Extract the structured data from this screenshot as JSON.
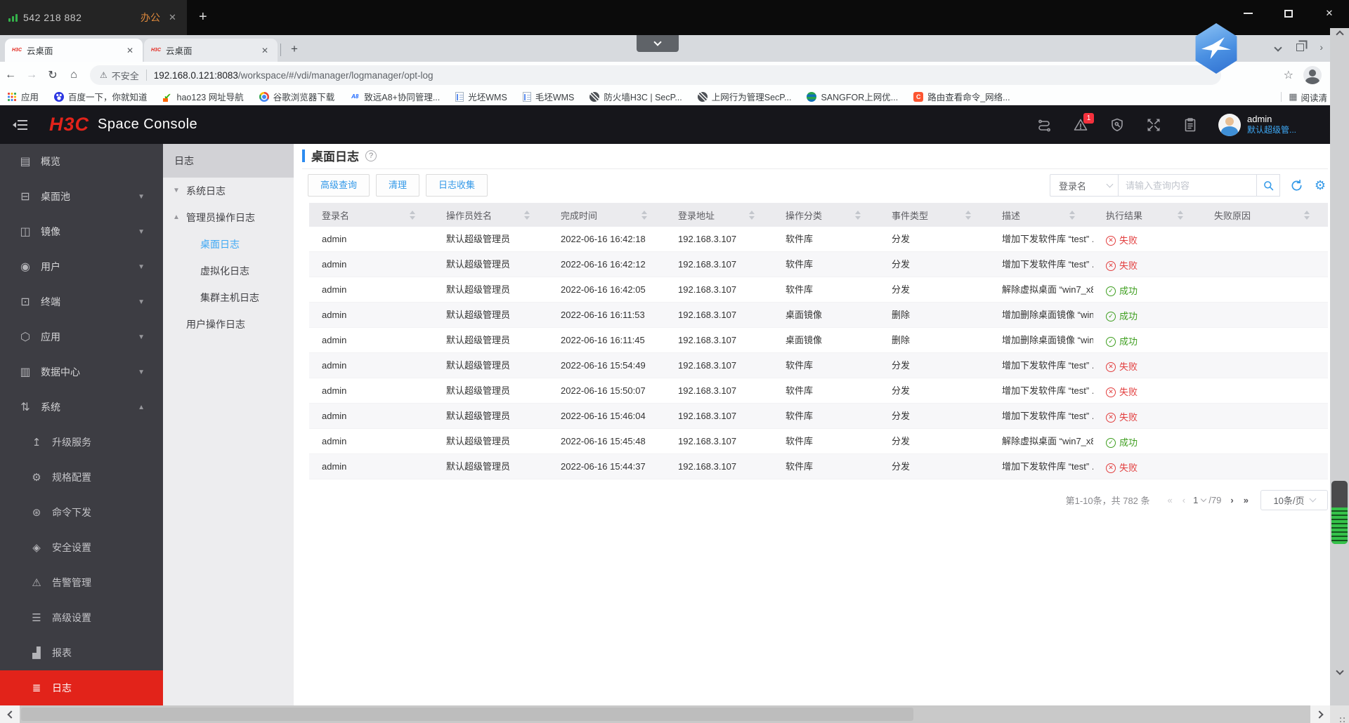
{
  "remote_bar": {
    "session_id": "542 218 882",
    "tab_label": "办公"
  },
  "browser": {
    "tab_favicon_text": "H3C",
    "tabs": [
      {
        "title": "云桌面"
      },
      {
        "title": "云桌面"
      }
    ],
    "address": {
      "security_label": "不安全",
      "host": "192.168.0.121:8083",
      "path": "/workspace/#/vdi/manager/logmanager/opt-log"
    },
    "bookmarks": [
      {
        "icon": "apps-grid-icon",
        "label": "应用"
      },
      {
        "icon": "baidu-icon",
        "label": "百度一下，你就知道"
      },
      {
        "icon": "hao123-icon",
        "label": "hao123 网址导航",
        "glyph": "✔"
      },
      {
        "icon": "chrome-icon",
        "label": "谷歌浏览器下载"
      },
      {
        "icon": "a8-icon",
        "label": "致远A8+协同管理...",
        "glyph": "A8"
      },
      {
        "icon": "doc-icon",
        "label": "光坯WMS"
      },
      {
        "icon": "doc-icon",
        "label": "毛坯WMS"
      },
      {
        "icon": "globe-icon",
        "label": "防火墙H3C | SecP..."
      },
      {
        "icon": "globe-icon",
        "label": "上网行为管理SecP..."
      },
      {
        "icon": "sangfor-icon",
        "label": "SANGFOR上网优..."
      },
      {
        "icon": "csdn-icon",
        "label": "路由查看命令_网络...",
        "glyph": "C"
      }
    ],
    "reading_list_label": "阅读清"
  },
  "app_header": {
    "logo_text": "H3C",
    "product_name": "Space Console",
    "alert_badge": "1",
    "user_name": "admin",
    "user_role": "默认超级管..."
  },
  "sidebar": {
    "items": [
      {
        "label": "概览",
        "icon": "overview-icon",
        "expandable": false
      },
      {
        "label": "桌面池",
        "icon": "desktop-pool-icon",
        "expandable": true
      },
      {
        "label": "镜像",
        "icon": "image-icon",
        "expandable": true
      },
      {
        "label": "用户",
        "icon": "user-icon",
        "expandable": true
      },
      {
        "label": "终端",
        "icon": "terminal-icon",
        "expandable": true
      },
      {
        "label": "应用",
        "icon": "app-icon",
        "expandable": true
      },
      {
        "label": "数据中心",
        "icon": "datacenter-icon",
        "expandable": true
      },
      {
        "label": "系统",
        "icon": "system-icon",
        "expandable": true,
        "expanded": true
      }
    ],
    "system_children": [
      {
        "label": "升级服务",
        "icon": "upgrade-icon"
      },
      {
        "label": "规格配置",
        "icon": "spec-icon"
      },
      {
        "label": "命令下发",
        "icon": "command-icon"
      },
      {
        "label": "安全设置",
        "icon": "security-icon"
      },
      {
        "label": "告警管理",
        "icon": "alarm-icon"
      },
      {
        "label": "高级设置",
        "icon": "advanced-icon"
      },
      {
        "label": "报表",
        "icon": "report-icon"
      },
      {
        "label": "日志",
        "icon": "log-icon",
        "active": true
      }
    ]
  },
  "log_panel": {
    "title": "日志",
    "tree": [
      {
        "label": "系统日志",
        "level": 0,
        "arrow": "collapsed"
      },
      {
        "label": "管理员操作日志",
        "level": 0,
        "arrow": "expanded"
      },
      {
        "label": "桌面日志",
        "level": 1,
        "active": true
      },
      {
        "label": "虚拟化日志",
        "level": 1
      },
      {
        "label": "集群主机日志",
        "level": 1
      },
      {
        "label": "用户操作日志",
        "level": 0
      }
    ]
  },
  "main": {
    "page_title": "桌面日志",
    "toolbar": {
      "advanced_query": "高级查询",
      "clean": "清理",
      "log_collect": "日志收集"
    },
    "search": {
      "field": "登录名",
      "placeholder": "请输入查询内容"
    },
    "table": {
      "columns": [
        "登录名",
        "操作员姓名",
        "完成时间",
        "登录地址",
        "操作分类",
        "事件类型",
        "描述",
        "执行结果",
        "失败原因"
      ],
      "rows": [
        {
          "login": "admin",
          "operator": "默认超级管理员",
          "time": "2022-06-16 16:42:18",
          "address": "192.168.3.107",
          "category": "软件库",
          "event": "分发",
          "desc": "增加下发软件库 “test” ...",
          "result": "失败",
          "ok": false,
          "reason": ""
        },
        {
          "login": "admin",
          "operator": "默认超级管理员",
          "time": "2022-06-16 16:42:12",
          "address": "192.168.3.107",
          "category": "软件库",
          "event": "分发",
          "desc": "增加下发软件库 “test” ...",
          "result": "失败",
          "ok": false,
          "reason": ""
        },
        {
          "login": "admin",
          "operator": "默认超级管理员",
          "time": "2022-06-16 16:42:05",
          "address": "192.168.3.107",
          "category": "软件库",
          "event": "分发",
          "desc": "解除虚拟桌面 “win7_x8...",
          "result": "成功",
          "ok": true,
          "reason": ""
        },
        {
          "login": "admin",
          "operator": "默认超级管理员",
          "time": "2022-06-16 16:11:53",
          "address": "192.168.3.107",
          "category": "桌面镜像",
          "event": "删除",
          "desc": "增加删除桌面镜像 “win...",
          "result": "成功",
          "ok": true,
          "reason": ""
        },
        {
          "login": "admin",
          "operator": "默认超级管理员",
          "time": "2022-06-16 16:11:45",
          "address": "192.168.3.107",
          "category": "桌面镜像",
          "event": "删除",
          "desc": "增加删除桌面镜像 “win...",
          "result": "成功",
          "ok": true,
          "reason": ""
        },
        {
          "login": "admin",
          "operator": "默认超级管理员",
          "time": "2022-06-16 15:54:49",
          "address": "192.168.3.107",
          "category": "软件库",
          "event": "分发",
          "desc": "增加下发软件库 “test” ...",
          "result": "失败",
          "ok": false,
          "reason": ""
        },
        {
          "login": "admin",
          "operator": "默认超级管理员",
          "time": "2022-06-16 15:50:07",
          "address": "192.168.3.107",
          "category": "软件库",
          "event": "分发",
          "desc": "增加下发软件库 “test” ...",
          "result": "失败",
          "ok": false,
          "reason": ""
        },
        {
          "login": "admin",
          "operator": "默认超级管理员",
          "time": "2022-06-16 15:46:04",
          "address": "192.168.3.107",
          "category": "软件库",
          "event": "分发",
          "desc": "增加下发软件库 “test” ...",
          "result": "失败",
          "ok": false,
          "reason": ""
        },
        {
          "login": "admin",
          "operator": "默认超级管理员",
          "time": "2022-06-16 15:45:48",
          "address": "192.168.3.107",
          "category": "软件库",
          "event": "分发",
          "desc": "解除虚拟桌面 “win7_x8...",
          "result": "成功",
          "ok": true,
          "reason": ""
        },
        {
          "login": "admin",
          "operator": "默认超级管理员",
          "time": "2022-06-16 15:44:37",
          "address": "192.168.3.107",
          "category": "软件库",
          "event": "分发",
          "desc": "增加下发软件库 “test” ...",
          "result": "失败",
          "ok": false,
          "reason": ""
        }
      ]
    },
    "pagination": {
      "summary": "第1-10条，共 782 条",
      "page": "1",
      "total": "/79",
      "page_size": "10条/页"
    }
  }
}
